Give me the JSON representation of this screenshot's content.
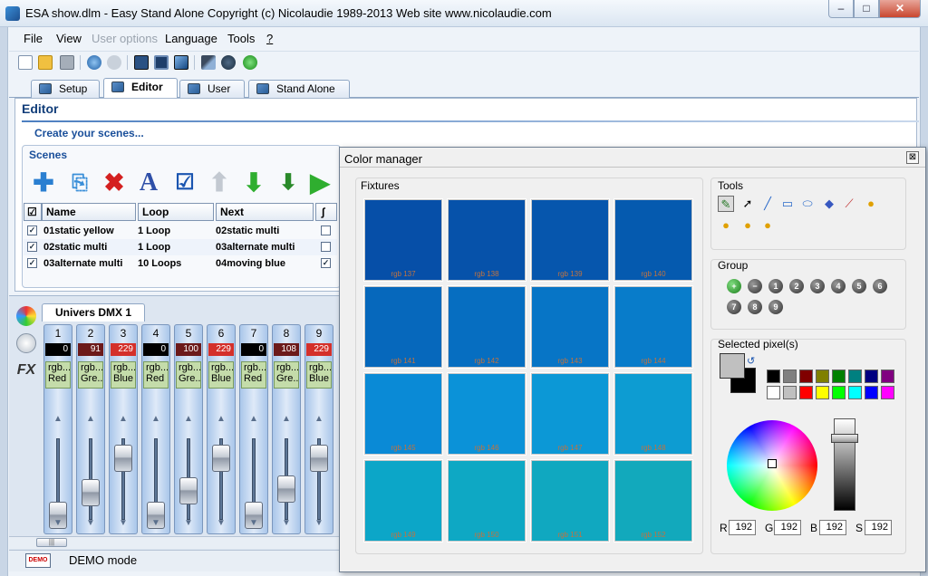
{
  "window": {
    "title": "ESA show.dlm - Easy Stand Alone    Copyright (c) Nicolaudie 1989-2013    Web site www.nicolaudie.com",
    "controls": {
      "minimize": "–",
      "maximize": "□",
      "close": "✕"
    }
  },
  "menu": [
    "File",
    "View",
    "User options",
    "Language",
    "Tools",
    "?"
  ],
  "toolbar_icons": [
    "new-file-icon",
    "open-folder-icon",
    "save-icon",
    "undo-icon",
    "redo-icon",
    "dmx-icon",
    "dmx-card-icon",
    "monitor-icon",
    "wand-icon",
    "globe-icon",
    "help-icon"
  ],
  "tabs": [
    "Setup",
    "Editor",
    "User",
    "Stand Alone"
  ],
  "editor": {
    "title": "Editor",
    "subtitle": "Create your scenes...",
    "scenes_label": "Scenes",
    "columns": [
      "Name",
      "Loop",
      "Next"
    ],
    "rows": [
      {
        "name": "01static yellow",
        "loop": "1 Loop",
        "next": "02static multi"
      },
      {
        "name": "02static multi",
        "loop": "1 Loop",
        "next": "03alternate multi"
      },
      {
        "name": "03alternate multi",
        "loop": "10 Loops",
        "next": "04moving blue"
      }
    ]
  },
  "universe": {
    "tab": "Univers DMX 1",
    "channels": [
      {
        "num": "1",
        "value": "0",
        "l1": "rgb...",
        "l2": "Red",
        "level": 0.0
      },
      {
        "num": "2",
        "value": "91",
        "l1": "rgb...",
        "l2": "Gre...",
        "level": 0.36
      },
      {
        "num": "3",
        "value": "229",
        "l1": "rgb...",
        "l2": "Blue",
        "level": 0.9
      },
      {
        "num": "4",
        "value": "0",
        "l1": "rgb...",
        "l2": "Red",
        "level": 0.0
      },
      {
        "num": "5",
        "value": "100",
        "l1": "rgb...",
        "l2": "Gre...",
        "level": 0.39
      },
      {
        "num": "6",
        "value": "229",
        "l1": "rgb...",
        "l2": "Blue",
        "level": 0.9
      },
      {
        "num": "7",
        "value": "0",
        "l1": "rgb...",
        "l2": "Red",
        "level": 0.0
      },
      {
        "num": "8",
        "value": "108",
        "l1": "rgb...",
        "l2": "Gre...",
        "level": 0.42
      },
      {
        "num": "9",
        "value": "229",
        "l1": "rgb...",
        "l2": "Blue",
        "level": 0.9
      }
    ]
  },
  "status": {
    "demo_icon": "DEMO",
    "text": "DEMO mode"
  },
  "color_manager": {
    "title": "Color manager",
    "close": "⊠",
    "fixtures_label": "Fixtures",
    "fixtures": [
      {
        "label": "rgb 137",
        "color": "#064fa8"
      },
      {
        "label": "rgb 138",
        "color": "#0652aa"
      },
      {
        "label": "rgb 139",
        "color": "#0656ad"
      },
      {
        "label": "rgb 140",
        "color": "#055aaf"
      },
      {
        "label": "rgb 141",
        "color": "#0668bc"
      },
      {
        "label": "rgb 142",
        "color": "#066ec1"
      },
      {
        "label": "rgb 143",
        "color": "#0775c6"
      },
      {
        "label": "rgb 144",
        "color": "#087cca"
      },
      {
        "label": "rgb 145",
        "color": "#0a8ad6"
      },
      {
        "label": "rgb 146",
        "color": "#0b92d8"
      },
      {
        "label": "rgb 147",
        "color": "#0c98d6"
      },
      {
        "label": "rgb 148",
        "color": "#0d9cd2"
      },
      {
        "label": "rgb 149",
        "color": "#0ca6c8"
      },
      {
        "label": "rgb 150",
        "color": "#0ea8c4"
      },
      {
        "label": "rgb 151",
        "color": "#10a8c0"
      },
      {
        "label": "rgb 152",
        "color": "#12a9bc"
      }
    ],
    "tools_label": "Tools",
    "group_label": "Group",
    "groups": [
      "+",
      "−",
      "1",
      "2",
      "3",
      "4",
      "5",
      "6",
      "7",
      "8",
      "9"
    ],
    "selected_label": "Selected pixel(s)",
    "swatches": [
      "#000000",
      "#808080",
      "#800000",
      "#808000",
      "#008000",
      "#008080",
      "#000080",
      "#800080",
      "#ffffff",
      "#c0c0c0",
      "#ff0000",
      "#ffff00",
      "#00ff00",
      "#00ffff",
      "#0000ff",
      "#ff00ff"
    ],
    "rgbs": [
      {
        "label": "R",
        "value": "192"
      },
      {
        "label": "G",
        "value": "192"
      },
      {
        "label": "B",
        "value": "192"
      },
      {
        "label": "S",
        "value": "192"
      }
    ],
    "brightness_level": 0.82
  }
}
